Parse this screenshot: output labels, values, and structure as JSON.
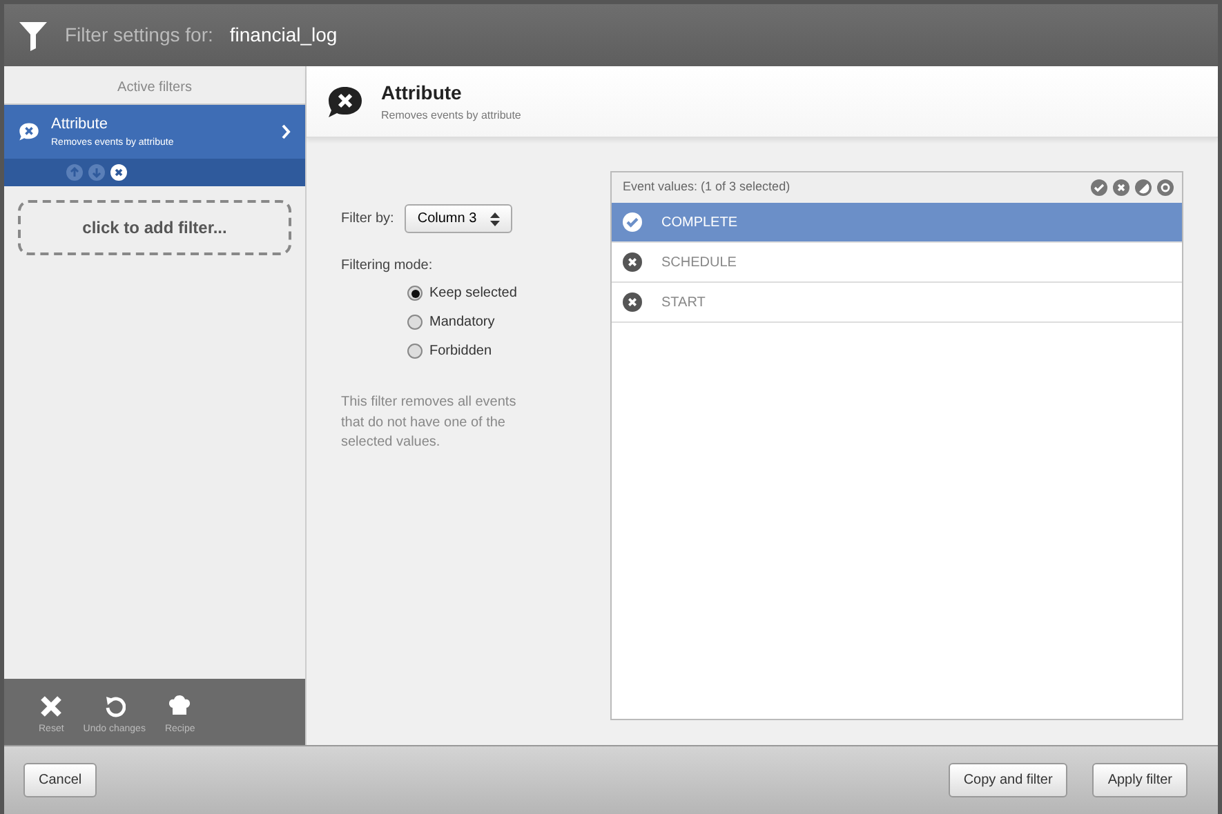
{
  "window": {
    "title_label": "Filter settings for:",
    "title_value": "financial_log"
  },
  "sidebar": {
    "heading": "Active filters",
    "filters": [
      {
        "title": "Attribute",
        "subtitle": "Removes events by attribute",
        "selected": true
      }
    ],
    "add_filter": "click to add filter...",
    "tools": [
      {
        "label": "Reset",
        "kind": "reset"
      },
      {
        "label": "Undo changes",
        "kind": "undo"
      },
      {
        "label": "Recipe",
        "kind": "recipe"
      }
    ]
  },
  "filter": {
    "title": "Attribute",
    "subtitle": "Removes events by attribute",
    "filter_by_label": "Filter by:",
    "filter_by_value": "Column 3",
    "mode_label": "Filtering mode:",
    "modes": [
      {
        "label": "Keep selected",
        "selected": true
      },
      {
        "label": "Mandatory",
        "selected": false
      },
      {
        "label": "Forbidden",
        "selected": false
      }
    ],
    "description": "This filter removes all events that do not have one of the selected values."
  },
  "event_values": {
    "header": "Event values:  (1 of 3 selected)",
    "items": [
      {
        "label": "COMPLETE",
        "selected": true
      },
      {
        "label": "SCHEDULE",
        "selected": false
      },
      {
        "label": "START",
        "selected": false
      }
    ]
  },
  "buttons": [
    {
      "label": "Cancel",
      "kind": "left"
    },
    {
      "label": "Copy and filter",
      "kind": "right"
    },
    {
      "label": "Apply filter",
      "kind": "right"
    }
  ]
}
